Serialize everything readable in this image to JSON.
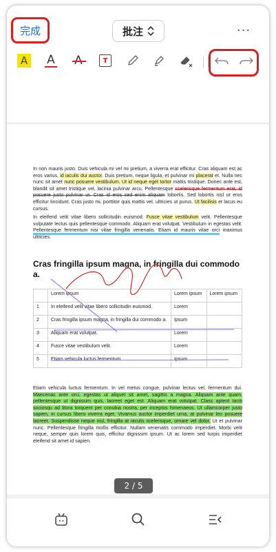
{
  "header": {
    "done_label": "完成",
    "mode_label": "批注",
    "more_glyph": "···"
  },
  "toolbar": {
    "tools": [
      "highlight-tool",
      "text-color-tool",
      "strikethrough-tool",
      "textbox-tool",
      "pencil-tool",
      "marker-tool",
      "eraser-tool",
      "undo",
      "redo"
    ],
    "highlight_glyph": "A",
    "text_color_glyph": "A",
    "strike_glyph": "A",
    "textbox_glyph": "T",
    "colors": {
      "highlight": "#f5e400",
      "accent_red": "#e31a1a",
      "primary_blue": "#1f6fd1"
    }
  },
  "document": {
    "para1": {
      "t1": "In non mauris justo. Duis vehicula mi vel mi pretium, a viverra erat efficitur. Cras aliquam est ac eros varius, ",
      "h1": "id iaculis dui auctor",
      "t2": ". Duis pretium, neque ligula, et pulvinar mi ",
      "h2": "placerat",
      "t3": " et. Nulla nec nunc sit amet ",
      "h3": "nunc posuere vestibulum. Ut id neque eget tortor",
      "t4": " mattis tristique. Donec ante est, blandit sit amet tristique vel, lacinia pulvinar arcu. Pellentesque ",
      "s1": "scelerisque fermentum erat, id posuere justo pulvinar ut. Cras id eros sed enim aliquam",
      "t5": " lobortis. Sed lobortis nisl ut eros efficitur tincidunt. Cras justo mi, porttitor quis mattis vel, ultricies ut purus. ",
      "h4": "Ut facilisis",
      "t6": " et lacus eu cursus."
    },
    "para2": {
      "t1": "In eleifend velit vitae libero sollicitudin euismod. ",
      "h1": "Fusce vitae vestibulum",
      "t2": " velit. Pellentesque vulputate lectus quis pellentesque commodo. Aliquam erat volutpat. Vestibulum in egestas velit. ",
      "u1": "Pellentesque fermentum nisi vitae fringilla venenatis. Etiam id mauris vitae orci",
      "t3": " maximus ultricies."
    },
    "heading": "Cras fringilla ipsum magna, in fringilla dui commodo a.",
    "table": {
      "header": [
        "",
        "Lorem ipsum",
        "Lorem ipsum",
        "Lorem ipsum"
      ],
      "rows": [
        [
          "1",
          "In eleifend velit vitae libero sollicitudin euismod.",
          "Lorem",
          ""
        ],
        [
          "2",
          "Cras fringilla ipsum magna, in fringilla dui commodo a.",
          "Ipsum",
          ""
        ],
        [
          "3",
          "Aliquam erat volutpat.",
          "Lorem",
          ""
        ],
        [
          "4",
          "Fusce vitae vestibulum velit.",
          "Lorem",
          ""
        ],
        [
          "5",
          "Etiam vehicula luctus fermentum.",
          "Ipsum",
          ""
        ]
      ]
    },
    "para3": {
      "t1": "Etiam vehicula luctus fermentum. In vel metus congue, pulvinar lectus vel, fermentum dui. ",
      "g1": "Maecenas ante orci, egestas ut aliquet sit amet, sagittis a magna. Aliquam ante quam, pellentesque ut dignissim quis, laoreet eget est. Aliquam erat volutpat. Class aptent taciti sociosqu ad litora torquent per conubia nostra, per inceptos himenaeos. Ut ullamcorper justo sapien, in cursus libero viverra eget. Vivamus auctor imperdiet urna, at pulvinar leo posuere laoreet. Suspendisse neque nisl, fringilla at iaculis scelerisque, ornare vel dolor.",
      "t2": " Ut et pulvinar nunc. Pellentesque fringilla mollis efficitur. Nullam venenatis commodo imperdiet. Morbi velit neque, semper quis lorem quis, efficitur dignissim ipsum. Ut ac lorem sed turpis imperdiet eleifend sit amet id sapien."
    }
  },
  "page_indicator": "2 / 5",
  "bottom_bar": {
    "icons": [
      "bot-icon",
      "search-icon",
      "outline-list-icon"
    ]
  }
}
